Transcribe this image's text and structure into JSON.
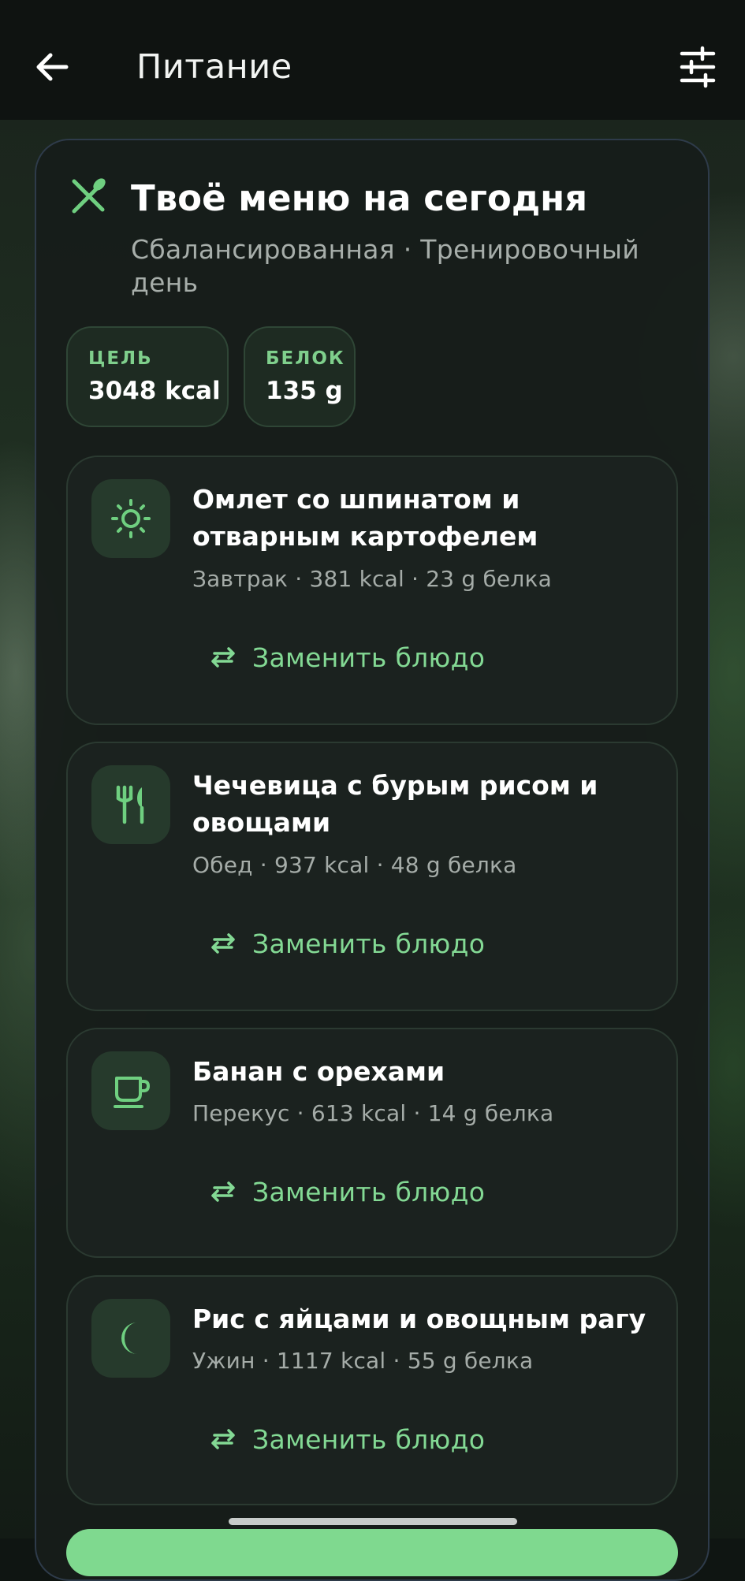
{
  "app": {
    "title": "Питание"
  },
  "menu": {
    "title": "Твоё меню на сегодня",
    "subtitle": "Сбалансированная · Тренировочный день",
    "stats": [
      {
        "label": "ЦЕЛЬ",
        "value": "3048 kcal"
      },
      {
        "label": "БЕЛОК",
        "value": "135 g"
      }
    ],
    "meals": [
      {
        "name": "Омлет со шпинатом и отварным картофелем",
        "meta": "Завтрак · 381 kcal · 23 g белка",
        "icon": "sun-icon"
      },
      {
        "name": "Чечевица с бурым рисом и овощами",
        "meta": "Обед · 937 kcal · 48 g белка",
        "icon": "utensils-icon"
      },
      {
        "name": "Банан с орехами",
        "meta": "Перекус · 613 kcal · 14 g белка",
        "icon": "cup-icon"
      },
      {
        "name": "Рис с яйцами и овощным рагу",
        "meta": "Ужин · 1117 kcal · 55 g белка",
        "icon": "moon-icon"
      }
    ],
    "swap_label": "Заменить блюдо"
  },
  "colors": {
    "accent": "#83d994",
    "background": "#0f1512",
    "card": "#171d1a"
  }
}
